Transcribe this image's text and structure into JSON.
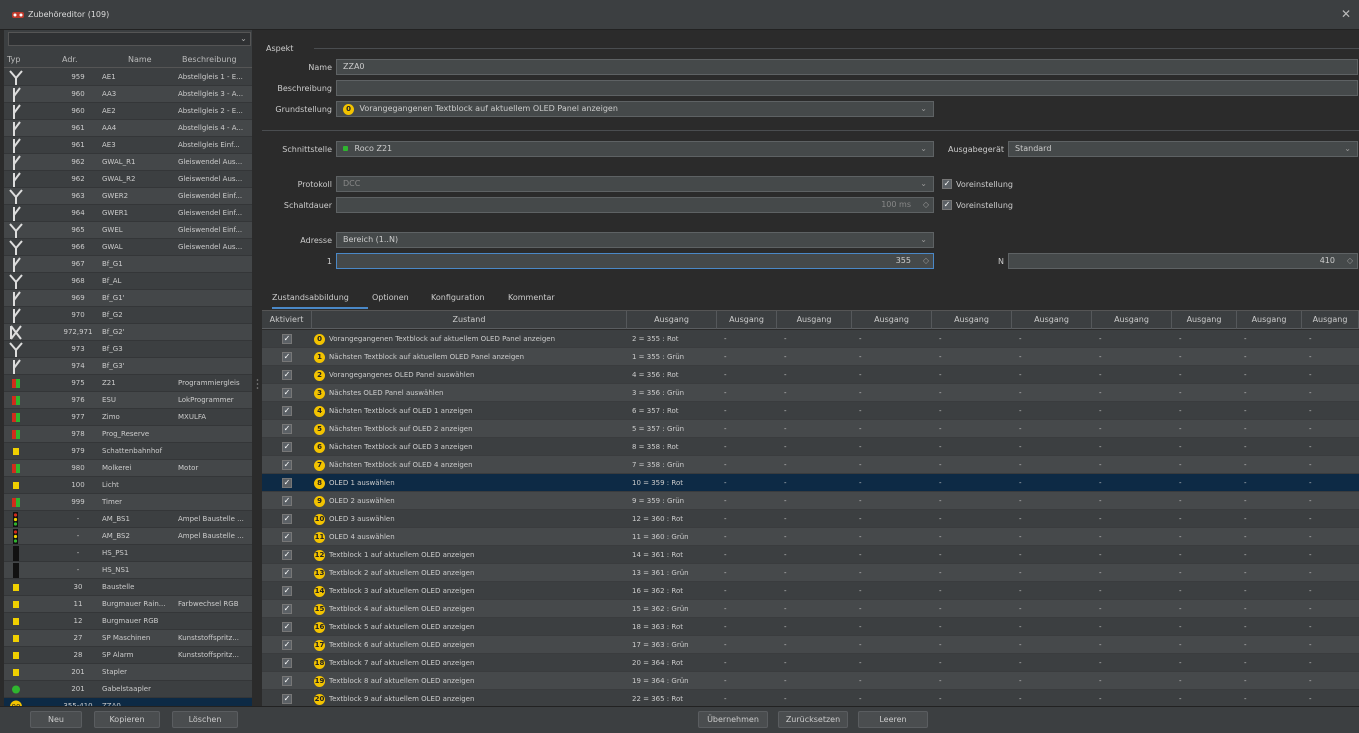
{
  "window": {
    "title": "Zubehöreditor (109)"
  },
  "left": {
    "headers": {
      "typ": "Typ",
      "adr": "Adr.",
      "name": "Name",
      "desc": "Beschreibung"
    },
    "rows": [
      {
        "icon": "turnout-y-icon",
        "adr": "959",
        "name": "AE1",
        "desc": "Abstellgleis 1 - E..."
      },
      {
        "icon": "turnout-right-icon",
        "adr": "960",
        "name": "AA3",
        "desc": "Abstellgleis 3 - A..."
      },
      {
        "icon": "turnout-right-icon",
        "adr": "960",
        "name": "AE2",
        "desc": "Abstellgleis 2 - E..."
      },
      {
        "icon": "turnout-right-icon",
        "adr": "961",
        "name": "AA4",
        "desc": "Abstellgleis 4 - A..."
      },
      {
        "icon": "turnout-right-icon",
        "adr": "961",
        "name": "AE3",
        "desc": "Abstellgleis Einf..."
      },
      {
        "icon": "turnout-right-icon",
        "adr": "962",
        "name": "GWAL_R1",
        "desc": "Gleiswendel Aus..."
      },
      {
        "icon": "turnout-right-icon",
        "adr": "962",
        "name": "GWAL_R2",
        "desc": "Gleiswendel Aus..."
      },
      {
        "icon": "turnout-y-icon",
        "adr": "963",
        "name": "GWER2",
        "desc": "Gleiswendel Einf..."
      },
      {
        "icon": "turnout-right-icon",
        "adr": "964",
        "name": "GWER1",
        "desc": "Gleiswendel Einf..."
      },
      {
        "icon": "turnout-y-icon",
        "adr": "965",
        "name": "GWEL",
        "desc": "Gleiswendel Einf..."
      },
      {
        "icon": "turnout-y-icon",
        "adr": "966",
        "name": "GWAL",
        "desc": "Gleiswendel Aus..."
      },
      {
        "icon": "turnout-right-icon",
        "adr": "967",
        "name": "Bf_G1",
        "desc": ""
      },
      {
        "icon": "turnout-y-icon",
        "adr": "968",
        "name": "Bf_AL",
        "desc": ""
      },
      {
        "icon": "turnout-right-icon",
        "adr": "969",
        "name": "Bf_G1'",
        "desc": ""
      },
      {
        "icon": "turnout-right-icon",
        "adr": "970",
        "name": "Bf_G2",
        "desc": ""
      },
      {
        "icon": "double-slip-icon",
        "adr": "972,971",
        "name": "Bf_G2'",
        "desc": ""
      },
      {
        "icon": "turnout-y-icon",
        "adr": "973",
        "name": "Bf_G3",
        "desc": ""
      },
      {
        "icon": "turnout-right-icon",
        "adr": "974",
        "name": "Bf_G3'",
        "desc": ""
      },
      {
        "icon": "red-green-icon",
        "adr": "975",
        "name": "Z21",
        "desc": "Programmiergleis"
      },
      {
        "icon": "red-green-icon",
        "adr": "976",
        "name": "ESU",
        "desc": "LokProgrammer"
      },
      {
        "icon": "red-green-icon",
        "adr": "977",
        "name": "Zimo",
        "desc": "MXULFA"
      },
      {
        "icon": "red-green-icon",
        "adr": "978",
        "name": "Prog_Reserve",
        "desc": ""
      },
      {
        "icon": "yellow-icon",
        "adr": "979",
        "name": "Schattenbahnhof",
        "desc": ""
      },
      {
        "icon": "red-green-icon",
        "adr": "980",
        "name": "Molkerei",
        "desc": "Motor"
      },
      {
        "icon": "yellow-icon",
        "adr": "100",
        "name": "Licht",
        "desc": ""
      },
      {
        "icon": "red-green-icon",
        "adr": "999",
        "name": "Timer",
        "desc": ""
      },
      {
        "icon": "signal-icon",
        "adr": "-",
        "name": "AM_BS1",
        "desc": "Ampel Baustelle ..."
      },
      {
        "icon": "signal-icon",
        "adr": "-",
        "name": "AM_BS2",
        "desc": "Ampel Baustelle ..."
      },
      {
        "icon": "main-signal-icon",
        "adr": "-",
        "name": "HS_PS1",
        "desc": ""
      },
      {
        "icon": "main-signal-icon",
        "adr": "-",
        "name": "HS_NS1",
        "desc": ""
      },
      {
        "icon": "yellow-icon",
        "adr": "30",
        "name": "Baustelle",
        "desc": ""
      },
      {
        "icon": "yellow-icon",
        "adr": "11",
        "name": "Burgmauer Rain...",
        "desc": "Farbwechsel RGB"
      },
      {
        "icon": "yellow-icon",
        "adr": "12",
        "name": "Burgmauer RGB",
        "desc": ""
      },
      {
        "icon": "yellow-icon",
        "adr": "27",
        "name": "SP Maschinen",
        "desc": "Kunststoffspritz..."
      },
      {
        "icon": "yellow-icon",
        "adr": "28",
        "name": "SP Alarm",
        "desc": "Kunststoffspritz..."
      },
      {
        "icon": "yellow-icon",
        "adr": "201",
        "name": "Stapler",
        "desc": ""
      },
      {
        "icon": "green-dot-icon",
        "adr": "201",
        "name": "Gabelstaapler",
        "desc": ""
      },
      {
        "icon": "zza-icon",
        "adr": "355-410",
        "name": "ZZA0",
        "desc": "",
        "selected": true
      }
    ],
    "buttons": {
      "new": "Neu",
      "copy": "Kopieren",
      "delete": "Löschen"
    }
  },
  "aspect": {
    "group": "Aspekt",
    "name_label": "Name",
    "name_value": "ZZA0",
    "desc_label": "Beschreibung",
    "desc_value": "",
    "default_label": "Grundstellung",
    "default_badge": "0",
    "default_value": "Vorangegangenen Textblock auf aktuellem OLED Panel anzeigen",
    "interface_label": "Schnittstelle",
    "interface_value": "Roco Z21",
    "output_label": "Ausgabegerät",
    "output_value": "Standard",
    "protocol_label": "Protokoll",
    "protocol_value": "DCC",
    "duration_label": "Schaltdauer",
    "duration_value": "100 ms",
    "preset1": "Voreinstellung",
    "preset2": "Voreinstellung",
    "address_label": "Adresse",
    "address_value": "Bereich (1..N)",
    "one_label": "1",
    "one_value": "355",
    "n_label": "N",
    "n_value": "410"
  },
  "tabs": [
    "Zustandsabbildung",
    "Optionen",
    "Konfiguration",
    "Kommentar"
  ],
  "table": {
    "headers": [
      "Aktiviert",
      "Zustand",
      "Ausgang",
      "Ausgang",
      "Ausgang",
      "Ausgang",
      "Ausgang",
      "Ausgang",
      "Ausgang",
      "Ausgang",
      "Ausgang",
      "Ausgang"
    ],
    "dash": "-",
    "rows": [
      {
        "n": "0",
        "state": "Vorangegangenen Textblock auf aktuellem OLED Panel anzeigen",
        "out": "2 = 355 : Rot"
      },
      {
        "n": "1",
        "state": "Nächsten Textblock auf aktuellem OLED Panel anzeigen",
        "out": "1 = 355 : Grün"
      },
      {
        "n": "2",
        "state": "Vorangegangenes OLED Panel auswählen",
        "out": "4 = 356 : Rot"
      },
      {
        "n": "3",
        "state": "Nächstes OLED Panel auswählen",
        "out": "3 = 356 : Grün"
      },
      {
        "n": "4",
        "state": "Nächsten Textblock auf OLED 1 anzeigen",
        "out": "6 = 357 : Rot"
      },
      {
        "n": "5",
        "state": "Nächsten Textblock auf OLED 2 anzeigen",
        "out": "5 = 357 : Grün"
      },
      {
        "n": "6",
        "state": "Nächsten Textblock auf OLED 3 anzeigen",
        "out": "8 = 358 : Rot"
      },
      {
        "n": "7",
        "state": "Nächsten Textblock auf OLED 4 anzeigen",
        "out": "7 = 358 : Grün"
      },
      {
        "n": "8",
        "state": "OLED 1 auswählen",
        "out": "10 = 359 : Rot",
        "selected": true
      },
      {
        "n": "9",
        "state": "OLED 2 auswählen",
        "out": "9 = 359 : Grün"
      },
      {
        "n": "10",
        "state": "OLED 3 auswählen",
        "out": "12 = 360 : Rot"
      },
      {
        "n": "11",
        "state": "OLED 4 auswählen",
        "out": "11 = 360 : Grün"
      },
      {
        "n": "12",
        "state": "Textblock 1 auf aktuellem OLED anzeigen",
        "out": "14 = 361 : Rot"
      },
      {
        "n": "13",
        "state": "Textblock 2 auf aktuellem OLED anzeigen",
        "out": "13 = 361 : Grün"
      },
      {
        "n": "14",
        "state": "Textblock 3 auf aktuellem OLED anzeigen",
        "out": "16 = 362 : Rot"
      },
      {
        "n": "15",
        "state": "Textblock 4 auf aktuellem OLED anzeigen",
        "out": "15 = 362 : Grün"
      },
      {
        "n": "16",
        "state": "Textblock 5 auf aktuellem OLED anzeigen",
        "out": "18 = 363 : Rot"
      },
      {
        "n": "17",
        "state": "Textblock 6 auf aktuellem OLED anzeigen",
        "out": "17 = 363 : Grün"
      },
      {
        "n": "18",
        "state": "Textblock 7 auf aktuellem OLED anzeigen",
        "out": "20 = 364 : Rot"
      },
      {
        "n": "19",
        "state": "Textblock 8 auf aktuellem OLED anzeigen",
        "out": "19 = 364 : Grün"
      },
      {
        "n": "20",
        "state": "Textblock 9 auf aktuellem OLED anzeigen",
        "out": "22 = 365 : Rot"
      }
    ]
  },
  "bottom": {
    "apply": "Übernehmen",
    "reset": "Zurücksetzen",
    "clear": "Leeren"
  },
  "colors": {
    "accent": "#4a88c7",
    "selection": "#0d2a45",
    "badge": "#f3c300",
    "signal_red": "#d12c1c",
    "signal_green": "#2fb52f",
    "signal_yellow": "#f0d000"
  }
}
